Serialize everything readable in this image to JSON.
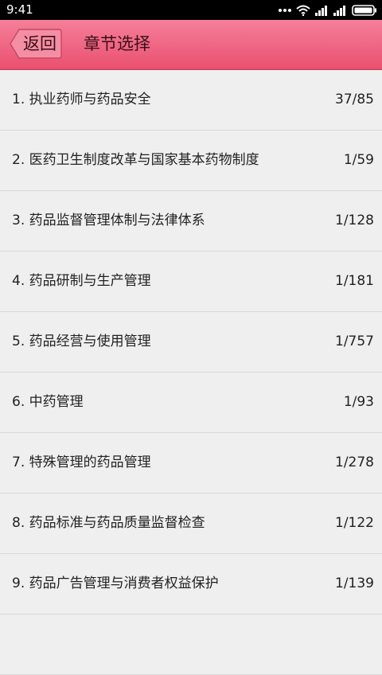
{
  "status_bar": {
    "time": "9:41",
    "icons": [
      "more-dots-icon",
      "wifi-icon",
      "signal-icon",
      "signal-icon",
      "battery-icon"
    ]
  },
  "header": {
    "back_label": "返回",
    "title": "章节选择",
    "accent_color": "#ef6a86"
  },
  "chapters": [
    {
      "title": "1. 执业药师与药品安全",
      "progress": "37/85"
    },
    {
      "title": "2. 医药卫生制度改革与国家基本药物制度",
      "progress": "1/59"
    },
    {
      "title": "3. 药品监督管理体制与法律体系",
      "progress": "1/128"
    },
    {
      "title": "4. 药品研制与生产管理",
      "progress": "1/181"
    },
    {
      "title": "5. 药品经营与使用管理",
      "progress": "1/757"
    },
    {
      "title": "6. 中药管理",
      "progress": "1/93"
    },
    {
      "title": "7. 特殊管理的药品管理",
      "progress": "1/278"
    },
    {
      "title": "8. 药品标准与药品质量监督检查",
      "progress": "1/122"
    },
    {
      "title": "9. 药品广告管理与消费者权益保护",
      "progress": "1/139"
    },
    {
      "title": "",
      "progress": ""
    }
  ]
}
